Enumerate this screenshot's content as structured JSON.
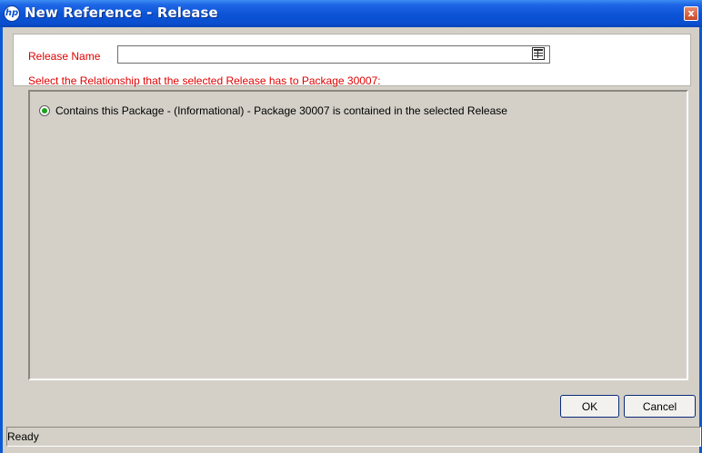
{
  "window": {
    "title": "New Reference - Release",
    "logo_icon": "hp-logo-icon",
    "close_icon": "close-icon",
    "close_glyph": "x",
    "logo_glyph": "hp",
    "title_bar_color": "#0b53d6",
    "close_color": "#c84a26"
  },
  "form": {
    "release_name_label": "Release Name",
    "release_name_value": "",
    "lookup_icon": "list-lookup-icon",
    "relationship_prompt": "Select the Relationship that the selected Release has to Package 30007:",
    "required_label_color": "#e00000"
  },
  "options": [
    {
      "label": "Contains this Package - (Informational) - Package 30007 is contained in the selected Release",
      "selected": true
    }
  ],
  "buttons": {
    "ok": "OK",
    "cancel": "Cancel"
  },
  "status": {
    "text": "Ready"
  }
}
